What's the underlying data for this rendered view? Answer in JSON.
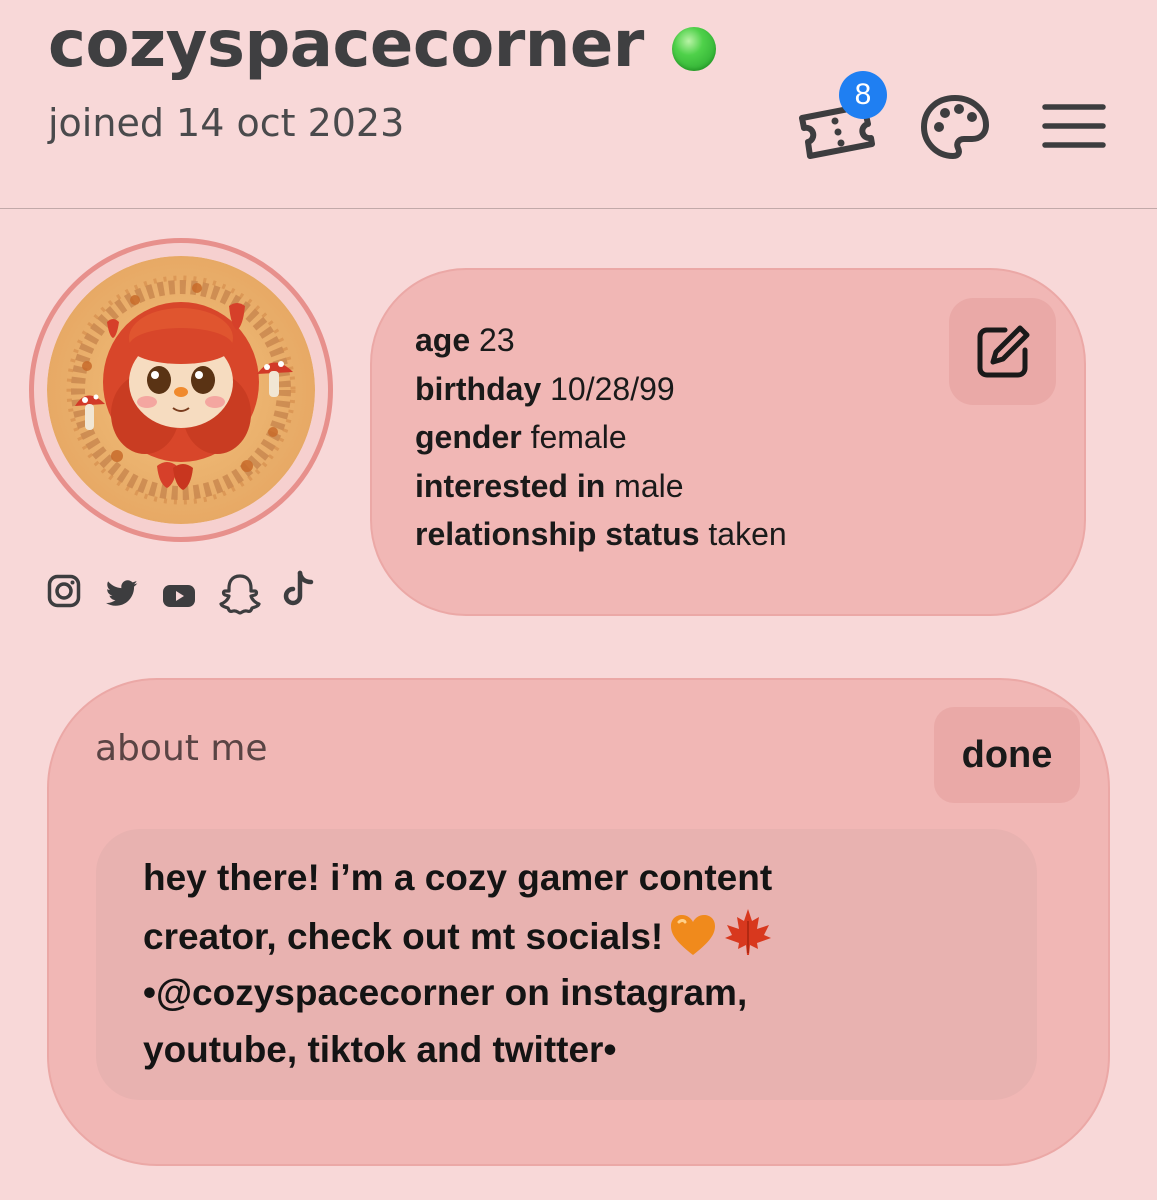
{
  "header": {
    "username": "cozyspacecorner",
    "online_status_color": "#3cc23f",
    "joined_text": "joined 14 oct 2023",
    "notification_count": "8",
    "icons": [
      "ticket-icon",
      "palette-icon",
      "menu-icon"
    ]
  },
  "profile": {
    "avatar_icon": "avatar-illustration",
    "socials": [
      "instagram-icon",
      "twitter-icon",
      "youtube-icon",
      "snapchat-icon",
      "tiktok-icon"
    ]
  },
  "info": {
    "edit_icon": "edit-icon",
    "rows": [
      {
        "label": "age",
        "value": "23"
      },
      {
        "label": "birthday",
        "value": "10/28/99"
      },
      {
        "label": "gender",
        "value": "female"
      },
      {
        "label": "interested in",
        "value": "male"
      },
      {
        "label": "relationship status",
        "value": "taken"
      }
    ]
  },
  "about": {
    "title": "about me",
    "done_label": "done",
    "lines": [
      "hey there! i’m a cozy gamer content",
      "creator, check out mt socials!",
      "•@cozyspacecorner on instagram,",
      "youtube, tiktok and twitter•"
    ],
    "emojis": [
      "orange-heart-icon",
      "maple-leaf-icon"
    ]
  },
  "colors": {
    "background": "#f8d8d8",
    "card": "#f1b7b5",
    "button": "#eaa9a7",
    "badge": "#1f7ff2",
    "avatar_ring": "#e7908c"
  }
}
